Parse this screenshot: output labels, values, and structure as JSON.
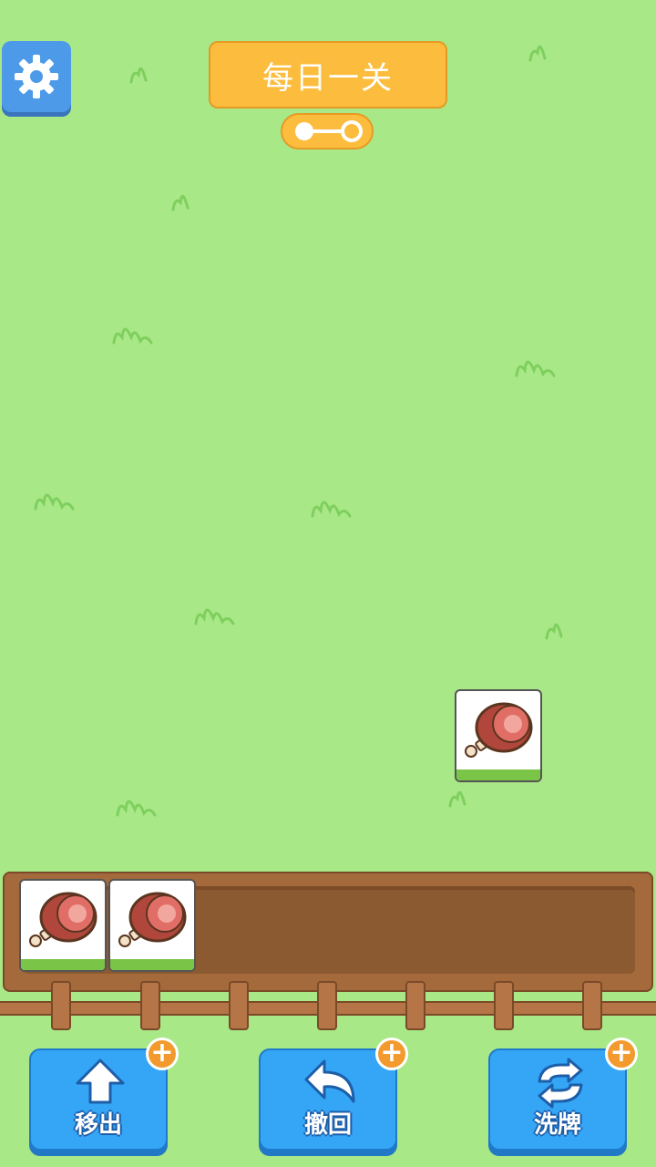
{
  "header": {
    "title": "每日一关",
    "settings_icon": "gear-icon",
    "progress_icon": "level-progress-indicator"
  },
  "board": {
    "tiles": [
      {
        "item": "ham-leg-icon"
      }
    ]
  },
  "tray": {
    "slots_filled": 2,
    "tiles": [
      {
        "item": "ham-leg-icon"
      },
      {
        "item": "ham-leg-icon"
      }
    ]
  },
  "tools": [
    {
      "label": "移出",
      "icon": "arrow-up-icon"
    },
    {
      "label": "撤回",
      "icon": "undo-arrow-icon"
    },
    {
      "label": "洗牌",
      "icon": "shuffle-icon"
    }
  ],
  "colors": {
    "background": "#a8e887",
    "title_bg": "#fcbd3e",
    "button_bg": "#35a5f5",
    "plus_badge": "#f39a2e",
    "tray_wood": "#a46a3c"
  }
}
